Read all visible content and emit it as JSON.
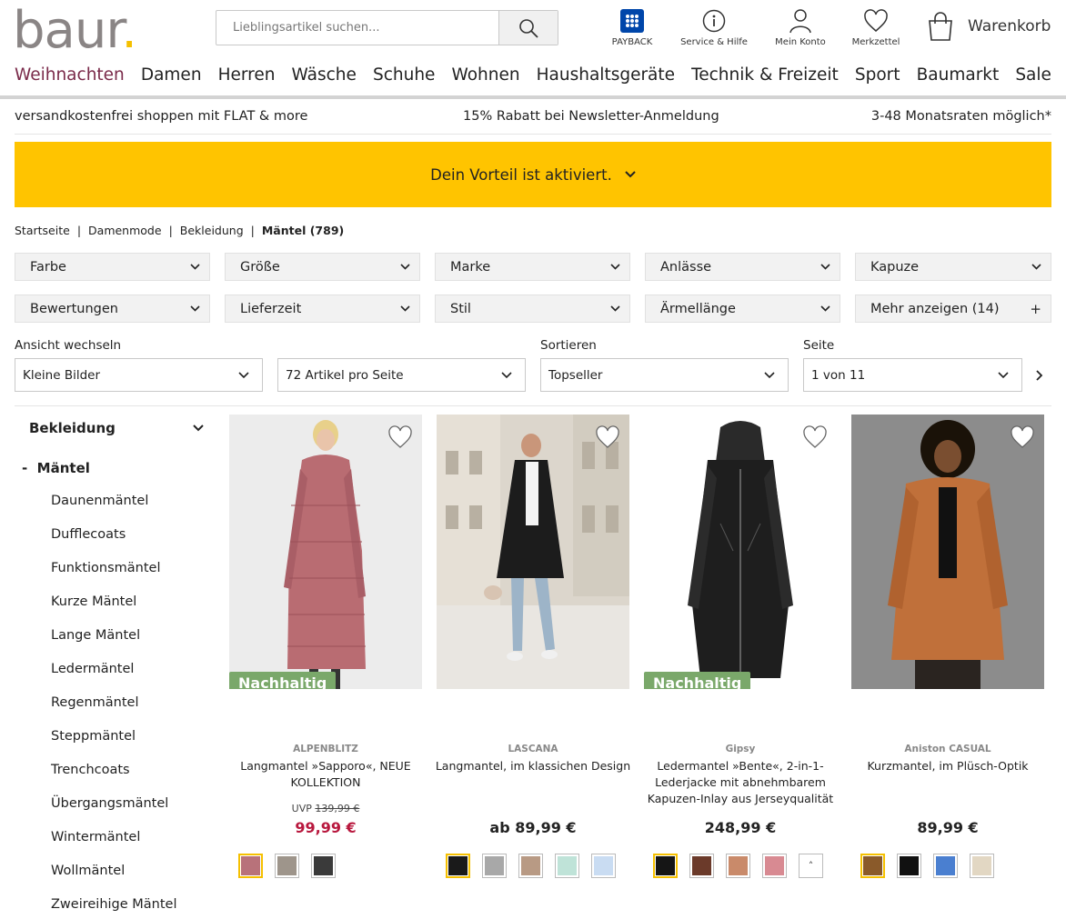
{
  "header": {
    "logo_text": "baur",
    "search_placeholder": "Lieblingsartikel suchen...",
    "icons": [
      {
        "name": "payback-icon",
        "label": "PAYBACK"
      },
      {
        "name": "service-icon",
        "label": "Service & Hilfe"
      },
      {
        "name": "account-icon",
        "label": "Mein Konto"
      },
      {
        "name": "wishlist-icon",
        "label": "Merkzettel"
      }
    ],
    "cart_label": "Warenkorb"
  },
  "nav": [
    "Weihnachten",
    "Damen",
    "Herren",
    "Wäsche",
    "Schuhe",
    "Wohnen",
    "Haushaltsgeräte",
    "Technik & Freizeit",
    "Sport",
    "Baumarkt",
    "Sale"
  ],
  "usp": [
    "versandkostenfrei shoppen mit FLAT & more",
    "15% Rabatt bei Newsletter-Anmeldung",
    "3-48 Monatsraten möglich*"
  ],
  "banner": "Dein Vorteil ist aktiviert.",
  "breadcrumb": [
    "Startseite",
    "Damenmode",
    "Bekleidung",
    "Mäntel (789)"
  ],
  "filters": [
    "Farbe",
    "Größe",
    "Marke",
    "Anlässe",
    "Kapuze",
    "Bewertungen",
    "Lieferzeit",
    "Stil",
    "Ärmellänge",
    "Mehr anzeigen (14)"
  ],
  "controls": {
    "view_label": "Ansicht wechseln",
    "view_value": "Kleine Bilder",
    "per_page_value": "72 Artikel pro Seite",
    "sort_label": "Sortieren",
    "sort_value": "Topseller",
    "page_label": "Seite",
    "page_value": "1 von 11"
  },
  "sidebar": {
    "heading": "Bekleidung",
    "current": "Mäntel",
    "items": [
      "Daunenmäntel",
      "Dufflecoats",
      "Funktionsmäntel",
      "Kurze Mäntel",
      "Lange Mäntel",
      "Ledermäntel",
      "Regenmäntel",
      "Steppmäntel",
      "Trenchcoats",
      "Übergangsmäntel",
      "Wintermäntel",
      "Wollmäntel",
      "Zweireihige Mäntel"
    ]
  },
  "products": [
    {
      "brand": "ALPENBLITZ",
      "name": "Langmantel »Sapporo«, NEUE KOLLEKTION",
      "uvp_label": "UVP",
      "uvp_price": "139,99 €",
      "price": "99,99 €",
      "badge": "Nachhaltig",
      "colors": [
        "#b8727a",
        "#9e958b",
        "#3a3a3a"
      ]
    },
    {
      "brand": "LASCANA",
      "name": "Langmantel, im klassichen Design",
      "price": "ab 89,99 €",
      "colors": [
        "#1a1a1a",
        "#a8a8a8",
        "#b89a84",
        "#bfe3d8",
        "#c9dcf2"
      ]
    },
    {
      "brand": "Gipsy",
      "name": "Ledermantel »Bente«, 2-in-1-Lederjacke mit abnehmbarem Kapuzen-Inlay aus Jerseyqualität",
      "price": "248,99 €",
      "badge": "Nachhaltig",
      "colors": [
        "#151515",
        "#6b3a2a",
        "#c98a6a",
        "#d88a92"
      ],
      "more_symbol": "˄"
    },
    {
      "brand": "Aniston CASUAL",
      "name": "Kurzmantel, im Plüsch-Optik",
      "price": "89,99 €",
      "colors": [
        "#8a5a2a",
        "#111111",
        "#4a7fd0",
        "#e2d7c3"
      ]
    }
  ],
  "colors": {
    "accent": "#ffc400",
    "sale": "#b8173d",
    "badge": "#7aa86a",
    "nav_active": "#7a2a4a"
  }
}
